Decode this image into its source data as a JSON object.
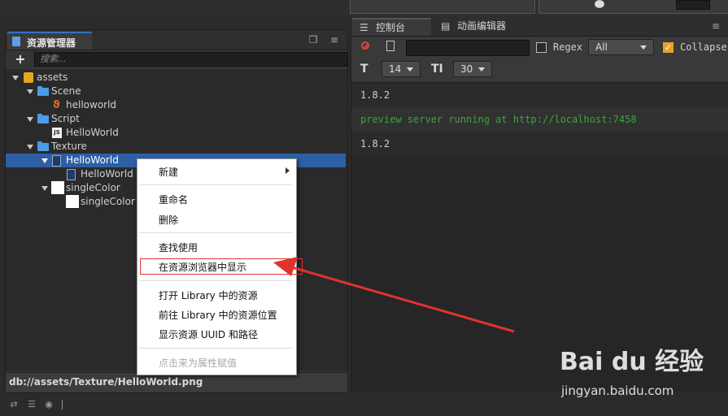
{
  "assets_panel": {
    "tab_label": "资源管理器",
    "search_placeholder": "搜索...",
    "tree": [
      {
        "label": "assets"
      },
      {
        "label": "Scene"
      },
      {
        "label": "helloworld"
      },
      {
        "label": "Script"
      },
      {
        "label": "HelloWorld"
      },
      {
        "label": "Texture"
      },
      {
        "label": "HelloWorld"
      },
      {
        "label": "HelloWorld"
      },
      {
        "label": "singleColor"
      },
      {
        "label": "singleColor"
      }
    ],
    "status_path": "db://assets/Texture/HelloWorld.png"
  },
  "context_menu": {
    "items": [
      {
        "label": "新建"
      },
      {
        "label": "重命名"
      },
      {
        "label": "删除"
      },
      {
        "label": "查找使用"
      },
      {
        "label": "在资源浏览器中显示"
      },
      {
        "label": "打开 Library 中的资源"
      },
      {
        "label": "前往 Library 中的资源位置"
      },
      {
        "label": "显示资源 UUID 和路径"
      },
      {
        "label": "点击来为属性赋值"
      }
    ]
  },
  "console_panel": {
    "tabs": [
      {
        "label": "控制台"
      },
      {
        "label": "动画编辑器"
      }
    ],
    "regex_label": "Regex",
    "filter_select": "All",
    "collapse_label": "Collapse",
    "font_size_select": "14",
    "line_height_select": "30",
    "logs": [
      {
        "text": "1.8.2",
        "color": "#cfcfcf"
      },
      {
        "text": "preview server running at http://localhost:7458",
        "color": "#3aa53a"
      },
      {
        "text": "1.8.2",
        "color": "#cfcfcf"
      }
    ]
  },
  "watermark": {
    "brand": "Bai du 经验",
    "url": "jingyan.baidu.com"
  },
  "colors": {
    "accent": "#2d72c8",
    "selection": "#2d5fa5",
    "annotation_red": "#e0332e",
    "log_green": "#3aa53a"
  }
}
